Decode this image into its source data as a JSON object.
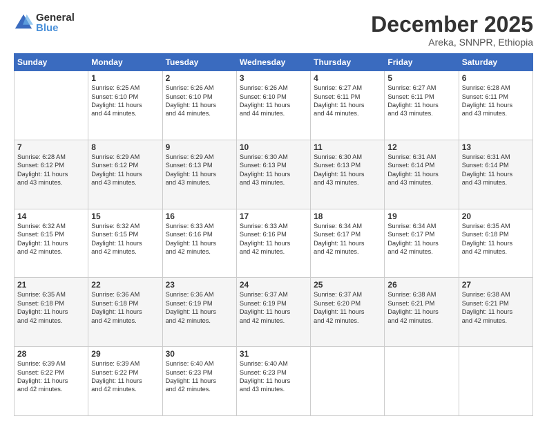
{
  "logo": {
    "general": "General",
    "blue": "Blue"
  },
  "header": {
    "month": "December 2025",
    "location": "Areka, SNNPR, Ethiopia"
  },
  "weekdays": [
    "Sunday",
    "Monday",
    "Tuesday",
    "Wednesday",
    "Thursday",
    "Friday",
    "Saturday"
  ],
  "weeks": [
    [
      {
        "day": "",
        "info": ""
      },
      {
        "day": "1",
        "info": "Sunrise: 6:25 AM\nSunset: 6:10 PM\nDaylight: 11 hours\nand 44 minutes."
      },
      {
        "day": "2",
        "info": "Sunrise: 6:26 AM\nSunset: 6:10 PM\nDaylight: 11 hours\nand 44 minutes."
      },
      {
        "day": "3",
        "info": "Sunrise: 6:26 AM\nSunset: 6:10 PM\nDaylight: 11 hours\nand 44 minutes."
      },
      {
        "day": "4",
        "info": "Sunrise: 6:27 AM\nSunset: 6:11 PM\nDaylight: 11 hours\nand 44 minutes."
      },
      {
        "day": "5",
        "info": "Sunrise: 6:27 AM\nSunset: 6:11 PM\nDaylight: 11 hours\nand 43 minutes."
      },
      {
        "day": "6",
        "info": "Sunrise: 6:28 AM\nSunset: 6:11 PM\nDaylight: 11 hours\nand 43 minutes."
      }
    ],
    [
      {
        "day": "7",
        "info": "Sunrise: 6:28 AM\nSunset: 6:12 PM\nDaylight: 11 hours\nand 43 minutes."
      },
      {
        "day": "8",
        "info": "Sunrise: 6:29 AM\nSunset: 6:12 PM\nDaylight: 11 hours\nand 43 minutes."
      },
      {
        "day": "9",
        "info": "Sunrise: 6:29 AM\nSunset: 6:13 PM\nDaylight: 11 hours\nand 43 minutes."
      },
      {
        "day": "10",
        "info": "Sunrise: 6:30 AM\nSunset: 6:13 PM\nDaylight: 11 hours\nand 43 minutes."
      },
      {
        "day": "11",
        "info": "Sunrise: 6:30 AM\nSunset: 6:13 PM\nDaylight: 11 hours\nand 43 minutes."
      },
      {
        "day": "12",
        "info": "Sunrise: 6:31 AM\nSunset: 6:14 PM\nDaylight: 11 hours\nand 43 minutes."
      },
      {
        "day": "13",
        "info": "Sunrise: 6:31 AM\nSunset: 6:14 PM\nDaylight: 11 hours\nand 43 minutes."
      }
    ],
    [
      {
        "day": "14",
        "info": "Sunrise: 6:32 AM\nSunset: 6:15 PM\nDaylight: 11 hours\nand 42 minutes."
      },
      {
        "day": "15",
        "info": "Sunrise: 6:32 AM\nSunset: 6:15 PM\nDaylight: 11 hours\nand 42 minutes."
      },
      {
        "day": "16",
        "info": "Sunrise: 6:33 AM\nSunset: 6:16 PM\nDaylight: 11 hours\nand 42 minutes."
      },
      {
        "day": "17",
        "info": "Sunrise: 6:33 AM\nSunset: 6:16 PM\nDaylight: 11 hours\nand 42 minutes."
      },
      {
        "day": "18",
        "info": "Sunrise: 6:34 AM\nSunset: 6:17 PM\nDaylight: 11 hours\nand 42 minutes."
      },
      {
        "day": "19",
        "info": "Sunrise: 6:34 AM\nSunset: 6:17 PM\nDaylight: 11 hours\nand 42 minutes."
      },
      {
        "day": "20",
        "info": "Sunrise: 6:35 AM\nSunset: 6:18 PM\nDaylight: 11 hours\nand 42 minutes."
      }
    ],
    [
      {
        "day": "21",
        "info": "Sunrise: 6:35 AM\nSunset: 6:18 PM\nDaylight: 11 hours\nand 42 minutes."
      },
      {
        "day": "22",
        "info": "Sunrise: 6:36 AM\nSunset: 6:18 PM\nDaylight: 11 hours\nand 42 minutes."
      },
      {
        "day": "23",
        "info": "Sunrise: 6:36 AM\nSunset: 6:19 PM\nDaylight: 11 hours\nand 42 minutes."
      },
      {
        "day": "24",
        "info": "Sunrise: 6:37 AM\nSunset: 6:19 PM\nDaylight: 11 hours\nand 42 minutes."
      },
      {
        "day": "25",
        "info": "Sunrise: 6:37 AM\nSunset: 6:20 PM\nDaylight: 11 hours\nand 42 minutes."
      },
      {
        "day": "26",
        "info": "Sunrise: 6:38 AM\nSunset: 6:21 PM\nDaylight: 11 hours\nand 42 minutes."
      },
      {
        "day": "27",
        "info": "Sunrise: 6:38 AM\nSunset: 6:21 PM\nDaylight: 11 hours\nand 42 minutes."
      }
    ],
    [
      {
        "day": "28",
        "info": "Sunrise: 6:39 AM\nSunset: 6:22 PM\nDaylight: 11 hours\nand 42 minutes."
      },
      {
        "day": "29",
        "info": "Sunrise: 6:39 AM\nSunset: 6:22 PM\nDaylight: 11 hours\nand 42 minutes."
      },
      {
        "day": "30",
        "info": "Sunrise: 6:40 AM\nSunset: 6:23 PM\nDaylight: 11 hours\nand 42 minutes."
      },
      {
        "day": "31",
        "info": "Sunrise: 6:40 AM\nSunset: 6:23 PM\nDaylight: 11 hours\nand 43 minutes."
      },
      {
        "day": "",
        "info": ""
      },
      {
        "day": "",
        "info": ""
      },
      {
        "day": "",
        "info": ""
      }
    ]
  ]
}
